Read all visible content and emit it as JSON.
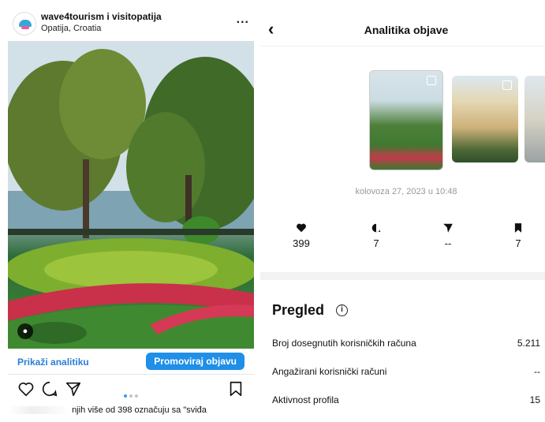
{
  "post": {
    "username": "wave4tourism i visitopatija",
    "location": "Opatija, Croatia",
    "more": "...",
    "view_insights": "Prikaži analitiku",
    "promote": "Promoviraj objavu",
    "likes_text": "njih više od 398 označuju sa \"sviđa"
  },
  "insights": {
    "back": "‹",
    "title": "Analitika objave",
    "date": "kolovoza 27, 2023 u 10:48",
    "stats": [
      {
        "icon": "heart-icon",
        "value": "399"
      },
      {
        "icon": "comment-icon",
        "value": "7"
      },
      {
        "icon": "share-icon",
        "value": "--"
      },
      {
        "icon": "bookmark-icon",
        "value": "7"
      }
    ],
    "overview_title": "Pregled",
    "info": "i",
    "rows": [
      {
        "label": "Broj dosegnutih korisničkih računa",
        "value": "5.211"
      },
      {
        "label": "Angažirani korisnički računi",
        "value": "--"
      },
      {
        "label": "Aktivnost profila",
        "value": "15"
      }
    ]
  },
  "colors": {
    "accent": "#1f8fe8",
    "link": "#2a7fd6"
  }
}
